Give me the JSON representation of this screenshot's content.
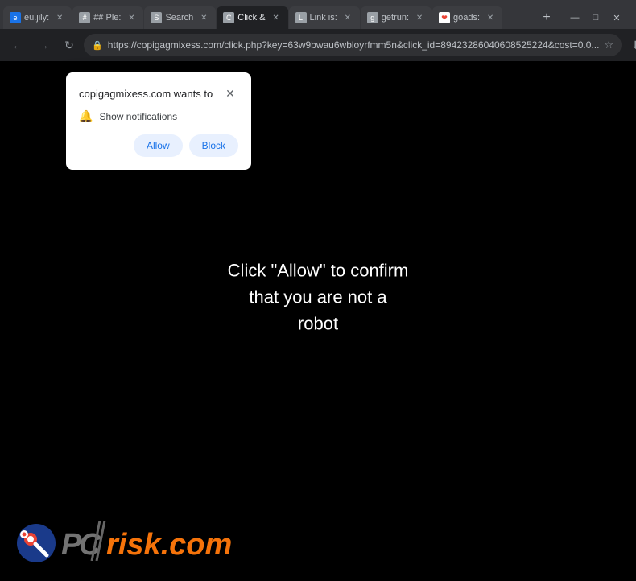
{
  "tabs": [
    {
      "id": "tab1",
      "label": "eu.jily:",
      "active": false,
      "favicon": "blue"
    },
    {
      "id": "tab2",
      "label": "## Ple:",
      "active": false,
      "favicon": "grey"
    },
    {
      "id": "tab3",
      "label": "Search",
      "active": false,
      "favicon": "grey"
    },
    {
      "id": "tab4",
      "label": "Click &",
      "active": true,
      "favicon": "grey"
    },
    {
      "id": "tab5",
      "label": "Link is:",
      "active": false,
      "favicon": "grey"
    },
    {
      "id": "tab6",
      "label": "getrun:",
      "active": false,
      "favicon": "grey"
    },
    {
      "id": "tab7",
      "label": "goads:",
      "active": false,
      "favicon": "heart"
    }
  ],
  "toolbar": {
    "url": "https://copigagmixess.com/click.php?key=63w9bwau6wbloyrfmm5n&click_id=89423286040608525224&cost=0.0...",
    "back_label": "←",
    "forward_label": "→",
    "reload_label": "↻",
    "new_tab_label": "+"
  },
  "window_controls": {
    "minimize": "—",
    "maximize": "□",
    "close": "✕"
  },
  "popup": {
    "title": "copigagmixess.com wants to",
    "notification_text": "Show notifications",
    "allow_label": "Allow",
    "block_label": "Block",
    "close_label": "✕"
  },
  "page": {
    "main_text": "Click \"Allow\" to confirm\nthat you are not a\nrobot"
  },
  "watermark": {
    "text_grey": "P",
    "text_slash": "C",
    "suffix_grey": "risk.com",
    "suffix_orange": "risk.com",
    "full_grey": "PC",
    "full_orange": "risk.com"
  }
}
